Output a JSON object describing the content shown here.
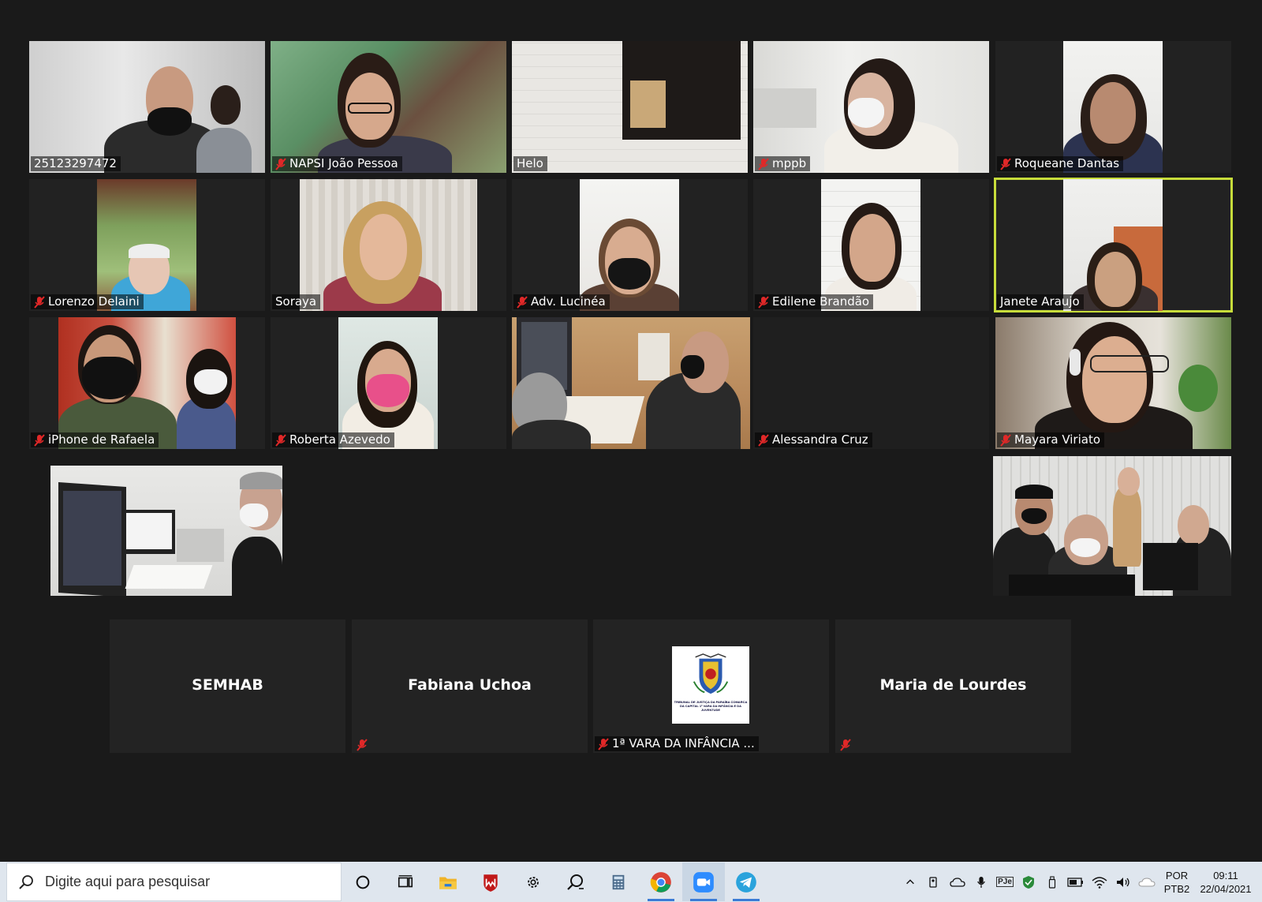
{
  "participants": {
    "p1": "25123297472",
    "p2": "NAPSI João Pessoa",
    "p3": "Helo",
    "p4": "mppb",
    "p5": "Roqueane Dantas",
    "p6": "Lorenzo Delaini",
    "p7": "Soraya",
    "p8": "Adv. Lucinéa",
    "p9": "Edilene Brandão",
    "p10": "Janete Araujo",
    "p11": "iPhone de Rafaela",
    "p12": "Roberta Azevedo",
    "p13": "Alessandra Cruz",
    "p14": "Mayara Viriato"
  },
  "avatar_tiles": {
    "a1": "SEMHAB",
    "a2": "Fabiana Uchoa",
    "a3_label": "1ª VARA DA INFÂNCIA ...",
    "a4": "Maria de Lourdes"
  },
  "court_logo_text": "TRIBUNAL DE JUSTIÇA DA PARAÍBA COMARCA DA CAPITAL 1ª VARA DA INFÂNCIA E DA JUVENTUDE",
  "active_speaker": "Janete Araujo",
  "taskbar": {
    "search_placeholder": "Digite aqui para pesquisar",
    "apps": [
      "cortana-circle-icon",
      "task-view-icon",
      "file-explorer-icon",
      "mcafee-icon",
      "settings-icon",
      "search-feedback-icon",
      "calculator-icon",
      "chrome-icon",
      "zoom-icon",
      "telegram-icon"
    ],
    "active_app": "zoom-icon",
    "tray_pje": "PJe",
    "lang_top": "POR",
    "lang_bottom": "PTB2",
    "time": "09:11",
    "date": "22/04/2021"
  },
  "colors": {
    "background": "#1a1a1a",
    "tile": "#222222",
    "speaker_border": "#c7dc3a",
    "muted_red": "#e02828"
  }
}
